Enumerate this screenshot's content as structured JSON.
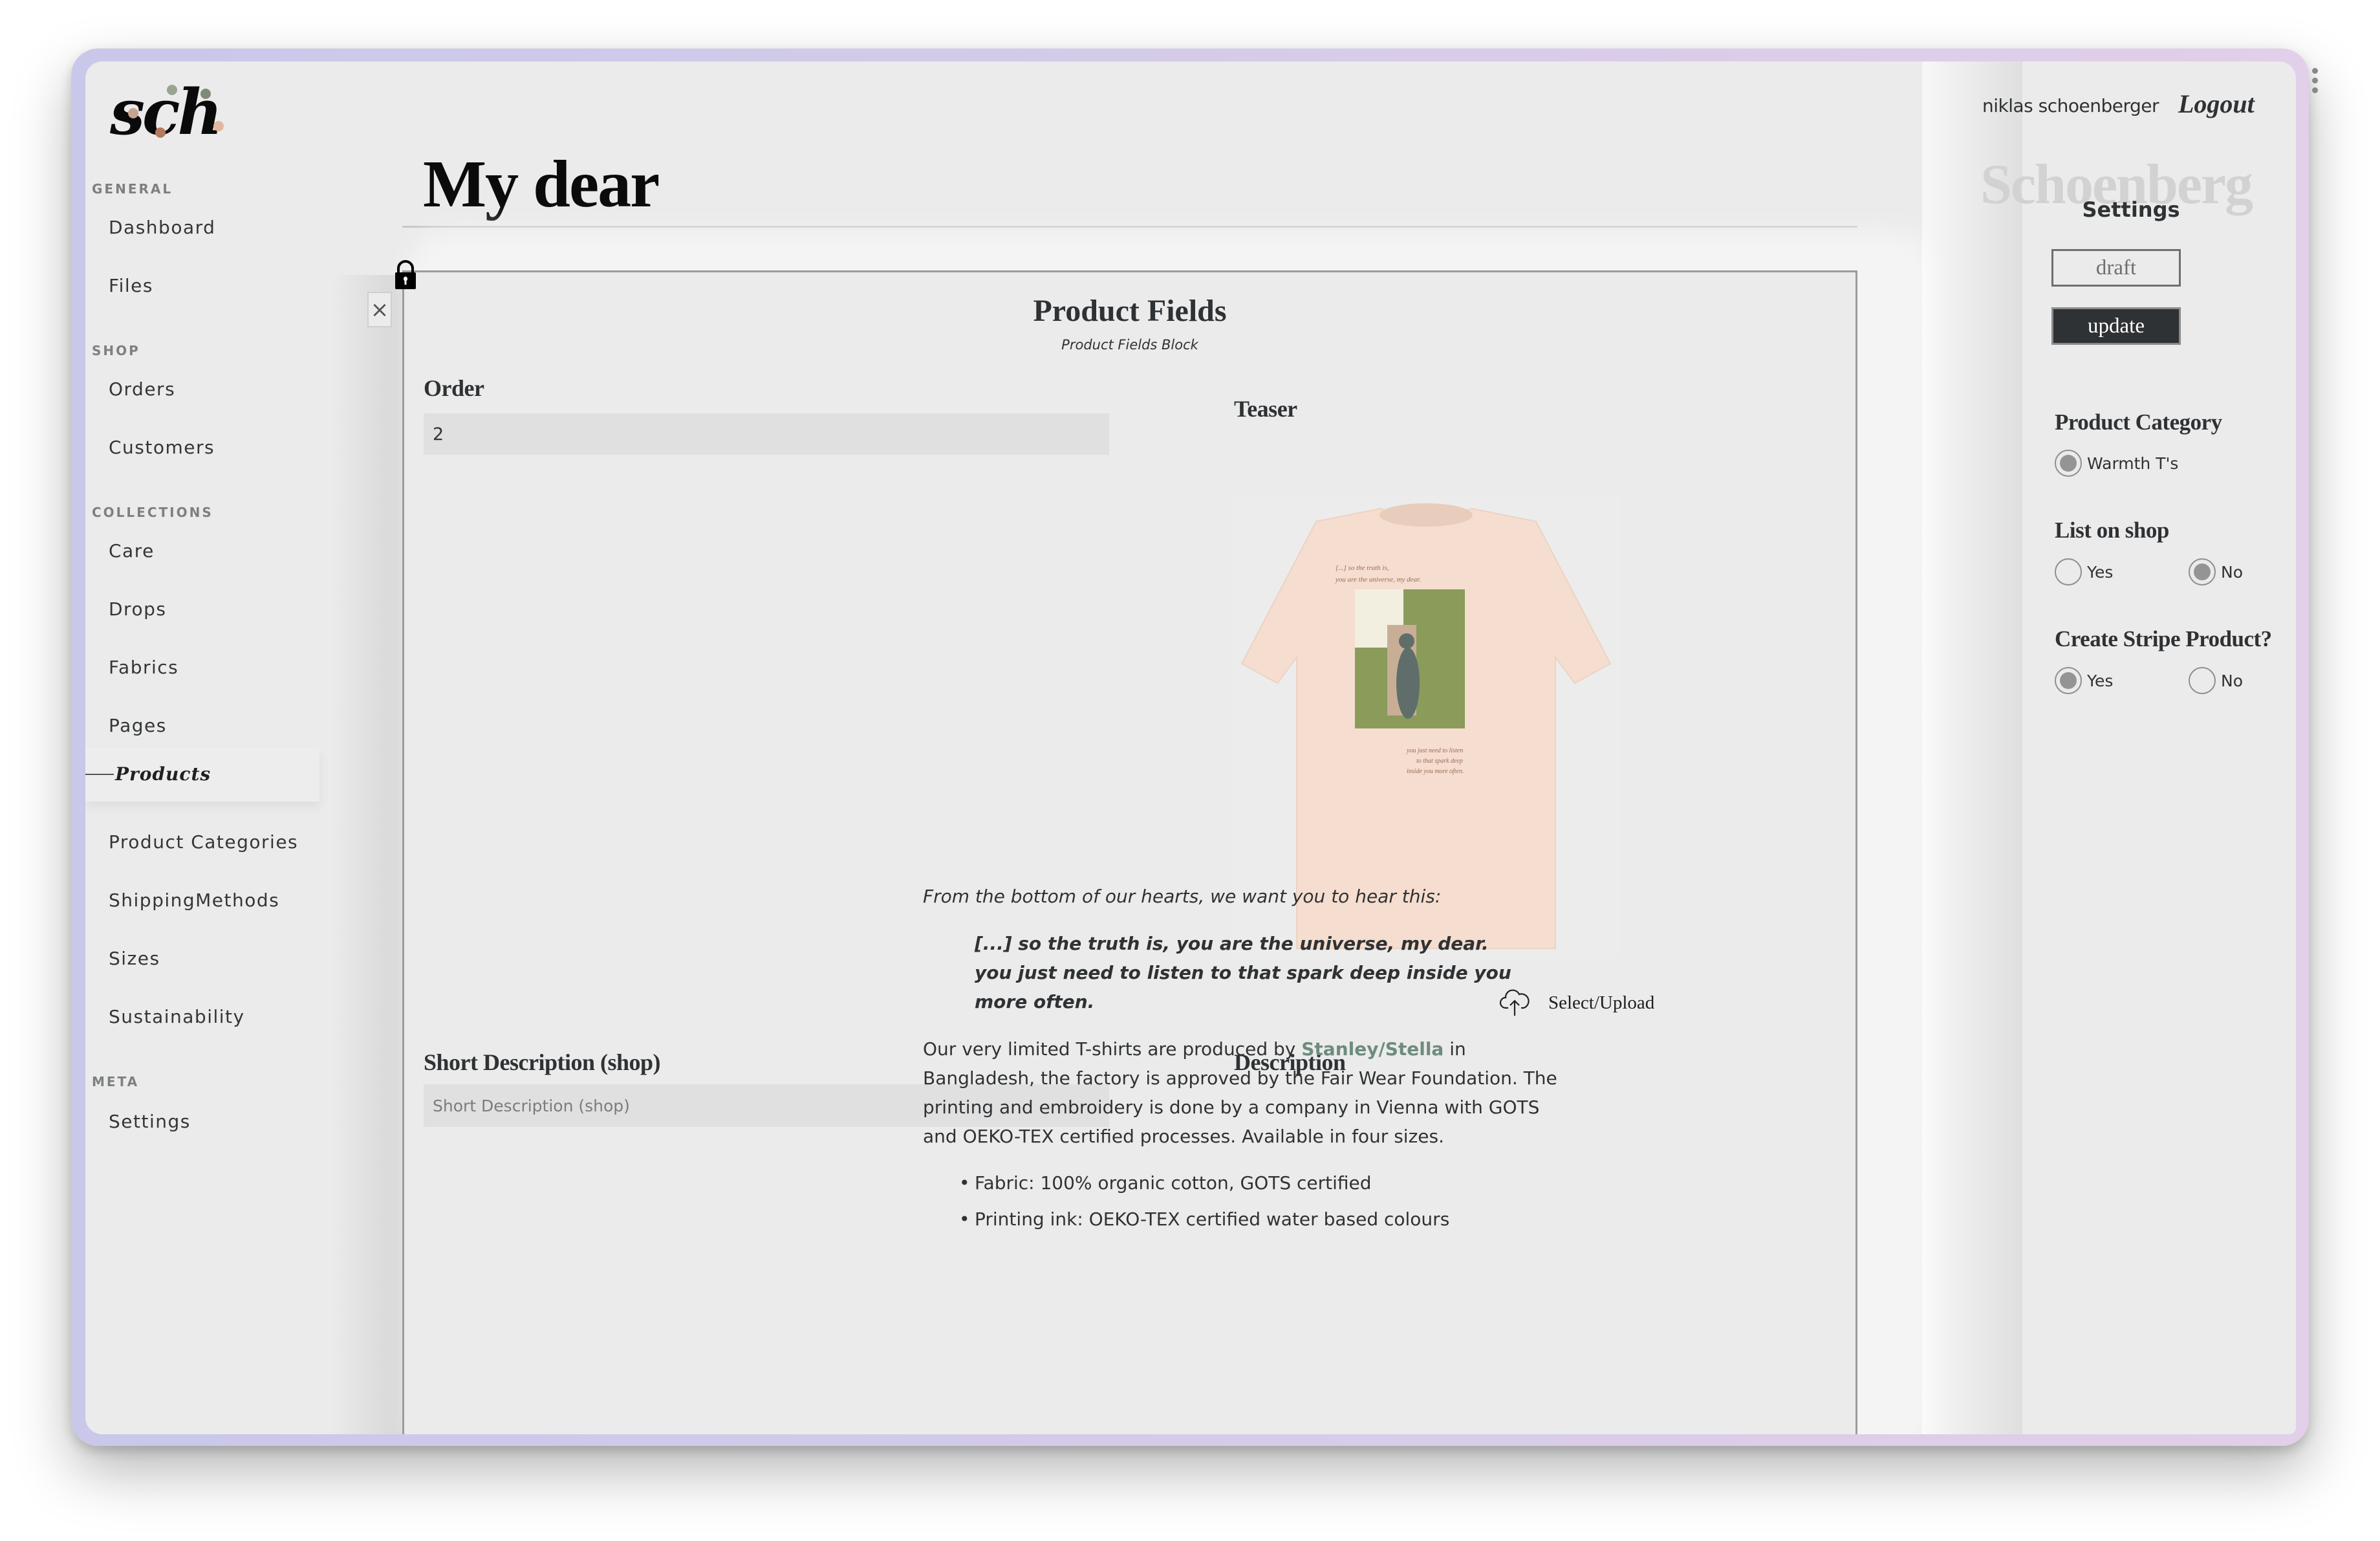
{
  "app": {
    "logo_text": "sch",
    "watermark": "Schoenberg"
  },
  "sidebar": {
    "sections": [
      {
        "label": "GENERAL",
        "items": [
          {
            "label": "Dashboard"
          },
          {
            "label": "Files"
          }
        ]
      },
      {
        "label": "SHOP",
        "items": [
          {
            "label": "Orders"
          },
          {
            "label": "Customers"
          }
        ]
      },
      {
        "label": "COLLECTIONS",
        "items": [
          {
            "label": "Care"
          },
          {
            "label": "Drops"
          },
          {
            "label": "Fabrics"
          },
          {
            "label": "Pages"
          },
          {
            "label": "Products",
            "active": true
          },
          {
            "label": "Product Categories"
          },
          {
            "label": "ShippingMethods"
          },
          {
            "label": "Sizes"
          },
          {
            "label": "Sustainability"
          }
        ]
      },
      {
        "label": "META",
        "items": [
          {
            "label": "Settings"
          }
        ]
      }
    ]
  },
  "header": {
    "user_name": "niklas schoenberger",
    "logout_label": "Logout"
  },
  "page": {
    "title": "My dear",
    "close_icon": "close-icon",
    "lock_icon": "lock-icon"
  },
  "block": {
    "title": "Product Fields",
    "subtitle": "Product Fields Block",
    "order": {
      "label": "Order",
      "value": "2"
    },
    "teaser": {
      "label": "Teaser",
      "image_alt": "Cream T-shirt with statue photo print",
      "upload_label": "Select/Upload",
      "upload_icon": "cloud-upload-icon"
    },
    "short_description": {
      "label": "Short Description (shop)",
      "value": "",
      "placeholder": "Short Description (shop)"
    },
    "description": {
      "label": "Description",
      "intro": "From the bottom of our hearts, we want you to hear this:",
      "quote_line1": "[...] so the truth is, you are the universe, my dear.",
      "quote_line2": "you just need to listen to that spark deep inside you more often.",
      "body_before_link": "Our very limited T-shirts are produced by ",
      "link_text": "Stanley/Stella",
      "body_after_link": " in Bangladesh, the factory is approved by the Fair Wear Foundation. The printing and embroidery is done by a company in Vienna with GOTS and OEKO-TEX certified processes. Available in four sizes.",
      "bullets": [
        "Fabric: 100% organic cotton, GOTS certified",
        "Printing ink: OEKO-TEX certified water based colours"
      ],
      "link_color": "#6e8c7e"
    }
  },
  "settings": {
    "title": "Settings",
    "draft_label": "draft",
    "update_label": "update",
    "product_category": {
      "label": "Product Category",
      "options": [
        {
          "label": "Warmth T's",
          "selected": true
        }
      ]
    },
    "list_on_shop": {
      "label": "List on shop",
      "options": [
        {
          "label": "Yes",
          "selected": false
        },
        {
          "label": "No",
          "selected": true
        }
      ]
    },
    "create_stripe_product": {
      "label": "Create Stripe Product?",
      "options": [
        {
          "label": "Yes",
          "selected": true
        },
        {
          "label": "No",
          "selected": false
        }
      ]
    }
  }
}
